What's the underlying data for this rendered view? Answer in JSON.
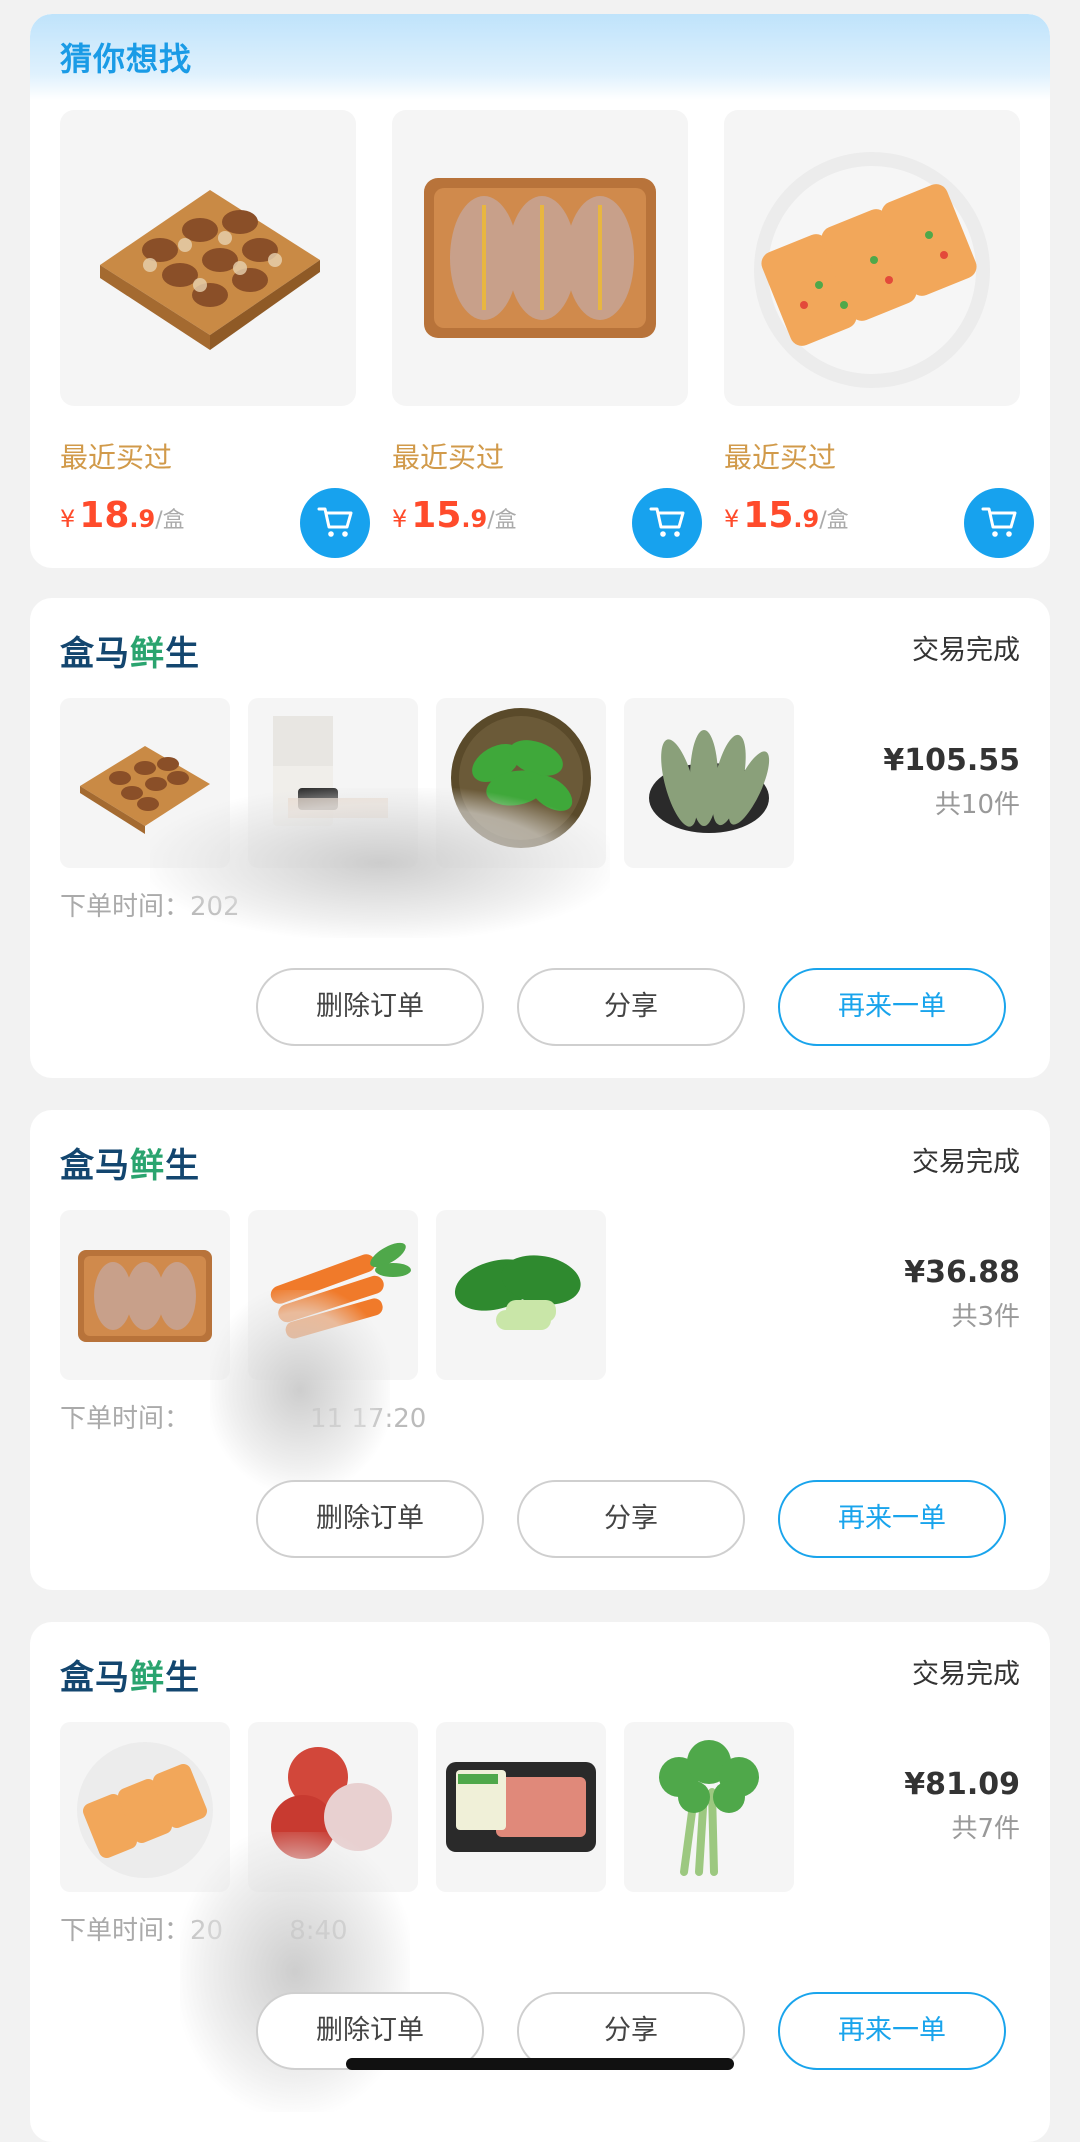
{
  "recommend": {
    "title": "猜你想找",
    "items": [
      {
        "label": "最近买过",
        "yen": "¥",
        "price_int": "18",
        "price_dec": ".9",
        "unit": "/盒"
      },
      {
        "label": "最近买过",
        "yen": "¥",
        "price_int": "15",
        "price_dec": ".9",
        "unit": "/盒"
      },
      {
        "label": "最近买过",
        "yen": "¥",
        "price_int": "15",
        "price_dec": ".9",
        "unit": "/盒"
      }
    ]
  },
  "orders": [
    {
      "brand_a": "盒马",
      "brand_b": "鲜",
      "brand_c": "生",
      "status": "交易完成",
      "amount": "¥105.55",
      "count": "共10件",
      "time_label": "下单时间：",
      "time_value": "202",
      "buttons": {
        "delete": "删除订单",
        "share": "分享",
        "reorder": "再来一单"
      }
    },
    {
      "brand_a": "盒马",
      "brand_b": "鲜",
      "brand_c": "生",
      "status": "交易完成",
      "amount": "¥36.88",
      "count": "共3件",
      "time_label": "下单时间：",
      "time_value": "11 17:20",
      "buttons": {
        "delete": "删除订单",
        "share": "分享",
        "reorder": "再来一单"
      }
    },
    {
      "brand_a": "盒马",
      "brand_b": "鲜",
      "brand_c": "生",
      "status": "交易完成",
      "amount": "¥81.09",
      "count": "共7件",
      "time_label": "下单时间：",
      "time_value": "20        8:40",
      "buttons": {
        "delete": "删除订单",
        "share": "分享",
        "reorder": "再来一单"
      }
    }
  ],
  "colors": {
    "accent": "#19a4ec",
    "price": "#ff4b2b",
    "label_gold": "#d19a4a",
    "brand": "#13466f"
  }
}
